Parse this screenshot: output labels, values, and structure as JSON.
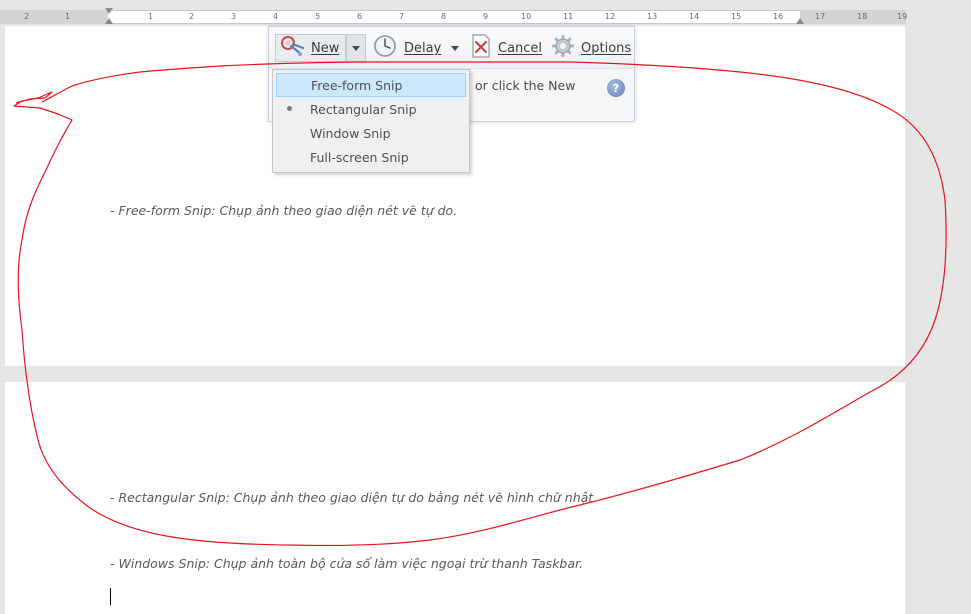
{
  "ruler": {
    "ticks_left": [
      "2",
      "1"
    ],
    "ticks_right": [
      "1",
      "2",
      "3",
      "4",
      "5",
      "6",
      "7",
      "8",
      "9",
      "10",
      "11",
      "12",
      "13",
      "14",
      "15",
      "16",
      "17",
      "18",
      "19"
    ]
  },
  "snipping_tool": {
    "new_label": "New",
    "delay_label": "Delay",
    "cancel_label": "Cancel",
    "options_label": "Options",
    "hint_text": "or click the New",
    "help_glyph": "?"
  },
  "new_menu": {
    "items": [
      {
        "label": "Free-form Snip",
        "highlighted": true,
        "selected": false
      },
      {
        "label": "Rectangular Snip",
        "highlighted": false,
        "selected": true
      },
      {
        "label": "Window Snip",
        "highlighted": false,
        "selected": false
      },
      {
        "label": "Full-screen Snip",
        "highlighted": false,
        "selected": false
      }
    ]
  },
  "document": {
    "line1": "- Free-form Snip: Chụp ảnh theo giao diện nét vẽ tự do.",
    "line2": "- Rectangular Snip: Chụp ảnh theo giao diện tự do bằng nét vẽ hình chữ nhật.",
    "line3": "- Windows Snip: Chụp ảnh toàn bộ cửa sổ làm việc ngoại trừ thanh Taskbar."
  },
  "colors": {
    "page_bg": "#ffffff",
    "workspace_bg": "#e6e6e6",
    "freeform_stroke": "#e8141b",
    "menu_highlight": "#cce8ff"
  },
  "icons": {
    "new": "scissors-icon",
    "delay": "clock-icon",
    "cancel": "cancel-icon",
    "options": "gear-icon",
    "help": "help-icon"
  }
}
